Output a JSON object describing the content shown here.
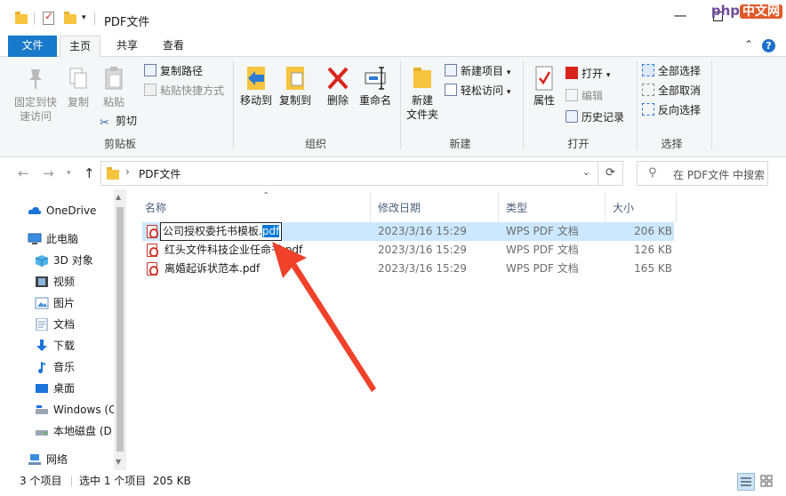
{
  "window": {
    "title": "PDF文件"
  },
  "watermark": {
    "brand": "php",
    "cn": "中文网"
  },
  "tabs": [
    {
      "label": "文件"
    },
    {
      "label": "主页"
    },
    {
      "label": "共享"
    },
    {
      "label": "查看"
    }
  ],
  "ribbon": {
    "clipboard": {
      "pin_line1": "固定到快",
      "pin_line2": "速访问",
      "copy": "复制",
      "paste": "粘贴",
      "copy_path": "复制路径",
      "paste_shortcut": "粘贴快捷方式",
      "cut": "剪切",
      "label": "剪贴板"
    },
    "organize": {
      "move_to": "移动到",
      "copy_to": "复制到",
      "delete": "删除",
      "rename": "重命名",
      "label": "组织"
    },
    "new": {
      "new_folder_line1": "新建",
      "new_folder_line2": "文件夹",
      "new_item": "新建项目",
      "easy_access": "轻松访问",
      "label": "新建"
    },
    "open": {
      "properties": "属性",
      "open": "打开",
      "edit": "编辑",
      "history": "历史记录",
      "label": "打开"
    },
    "select": {
      "select_all": "全部选择",
      "select_none": "全部取消",
      "invert": "反向选择",
      "label": "选择"
    }
  },
  "address": {
    "path": "PDF文件",
    "search_placeholder": "在 PDF文件 中搜索"
  },
  "nav": [
    {
      "label": "OneDrive",
      "icon": "cloud-icon"
    },
    {
      "label": "此电脑",
      "icon": "computer-icon"
    },
    {
      "label": "3D 对象",
      "icon": "cube-icon"
    },
    {
      "label": "视频",
      "icon": "video-icon"
    },
    {
      "label": "图片",
      "icon": "picture-icon"
    },
    {
      "label": "文档",
      "icon": "document-icon"
    },
    {
      "label": "下载",
      "icon": "download-icon"
    },
    {
      "label": "音乐",
      "icon": "music-icon"
    },
    {
      "label": "桌面",
      "icon": "desktop-icon"
    },
    {
      "label": "Windows (C",
      "icon": "drive-icon"
    },
    {
      "label": "本地磁盘 (D",
      "icon": "disk-icon"
    },
    {
      "label": "网络",
      "icon": "network-icon"
    }
  ],
  "columns": {
    "name": "名称",
    "modified": "修改日期",
    "type": "类型",
    "size": "大小"
  },
  "files": [
    {
      "name_base": "公司授权委托书模板.",
      "name_ext": "pdf",
      "modified": "2023/3/16 15:29",
      "type": "WPS PDF 文档",
      "size": "206 KB"
    },
    {
      "name": "红头文件科技企业任命书.pdf",
      "modified": "2023/3/16 15:29",
      "type": "WPS PDF 文档",
      "size": "126 KB"
    },
    {
      "name": "离婚起诉状范本.pdf",
      "modified": "2023/3/16 15:29",
      "type": "WPS PDF 文档",
      "size": "165 KB"
    }
  ],
  "status": {
    "count": "3 个项目",
    "selected": "选中 1 个项目  205 KB"
  },
  "colors": {
    "accent": "#1979ca",
    "selection": "#cce8ff",
    "arrow": "#f0412a"
  }
}
